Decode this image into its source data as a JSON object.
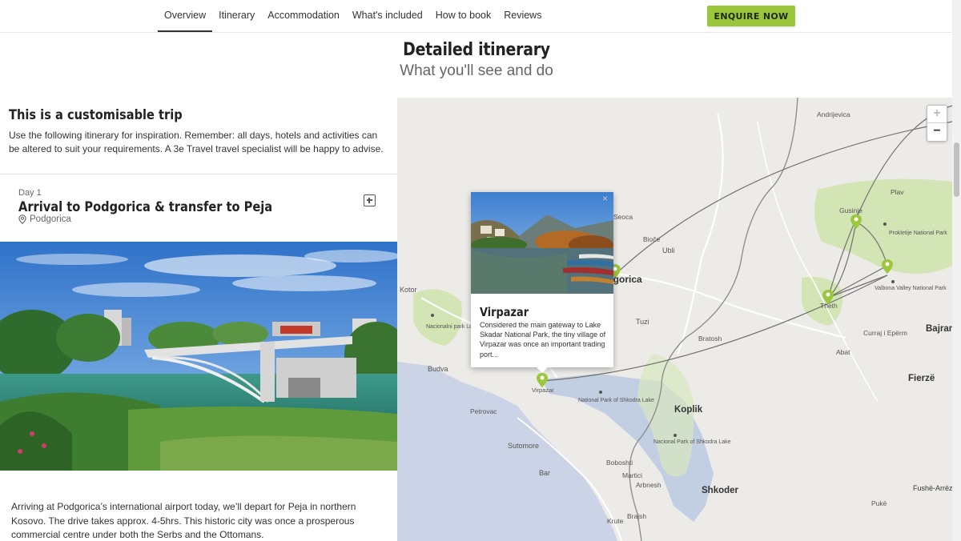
{
  "nav": {
    "links": [
      "Overview",
      "Itinerary",
      "Accommodation",
      "What's included",
      "How to book",
      "Reviews"
    ],
    "enquire_label": "ENQUIRE NOW"
  },
  "section": {
    "title": "Detailed itinerary",
    "subtitle": "What you'll see and do"
  },
  "customisable": {
    "title": "This is a customisable trip",
    "text": "Use the following itinerary for inspiration. Remember: all days, hotels and activities can be altered to suit your requirements. A 3e Travel travel specialist will be happy to advise."
  },
  "day": {
    "label": "Day 1",
    "title": "Arrival to Podgorica & transfer to Peja",
    "location": "Podgorica",
    "description": "Arriving at Podgorica’s international airport today, we’ll depart for Peja in northern Kosovo. The drive takes approx. 4-5hrs. This historic city was once a prosperous commercial centre under both the Serbs and the Ottomans."
  },
  "map": {
    "zoom_in": "+",
    "zoom_out": "−",
    "labels_small": [
      "Andrijevica",
      "Plav",
      "Gusinje",
      "Prokletije National Park",
      "Seoca",
      "Bioče",
      "Ubli",
      "Valbona Valley National Park",
      "Theth",
      "Kotor",
      "Nacionalni park Lovćen",
      "Tuzi",
      "Bratosh",
      "Curraj i Epërm",
      "Abat",
      "Budva",
      "Virpazar",
      "National Park of Shkodra Lake",
      "Petrovac",
      "Sutomore",
      "Nacional Park of Shkodra Lake",
      "Boboshti",
      "Martici",
      "Bar",
      "Arbnesh",
      "Pukë",
      "Brajsh",
      "Krute"
    ],
    "labels_large": [
      "Podgorica",
      "Bajram",
      "Fierzë",
      "Koplik",
      "Shkoder",
      "Fushë-Arrëz"
    ],
    "colors": {
      "water": "#cbd4e6",
      "land": "#ecebe8",
      "park": "#d3e5b4",
      "route": "#707070",
      "marker": "#9bc73d"
    }
  },
  "popup": {
    "title": "Virpazar",
    "text": "Considered the main gateway to Lake Skadar National Park, the tiny village of Virpazar was once an important trading port...",
    "close": "×"
  }
}
